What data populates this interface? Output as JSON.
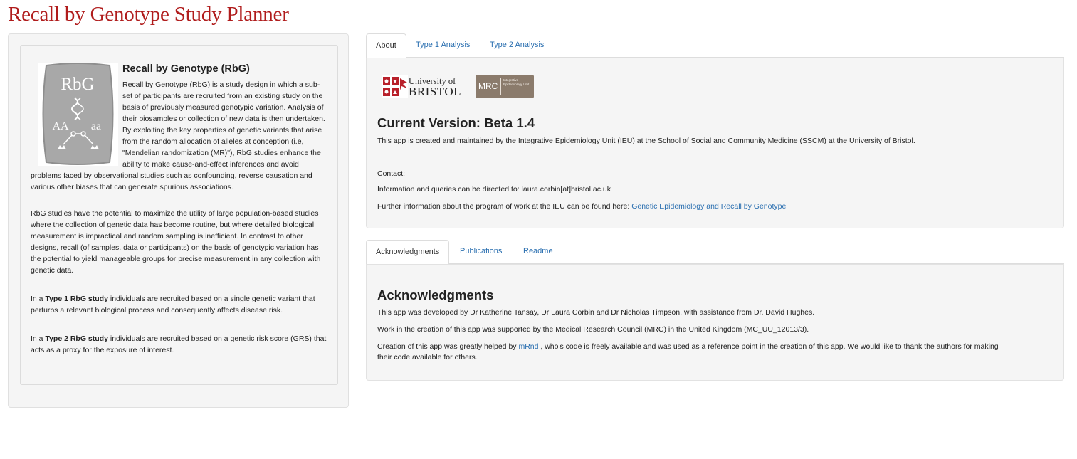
{
  "app": {
    "title": "Recall by Genotype Study Planner"
  },
  "sidebar": {
    "logo": {
      "top_text": "RbG",
      "left_text": "AA",
      "right_text": "aa"
    },
    "heading": "Recall by Genotype (RbG)",
    "para1": "Recall by Genotype (RbG) is a study design in which a sub-set of participants are recruited from an existing study on the basis of previously measured genotypic variation. Analysis of their biosamples or collection of new data is then undertaken. By exploiting the key properties of genetic variants that arise from the random allocation of alleles at conception (i.e, \"Mendelian randomization (MR)\"), RbG studies enhance the ability to make cause-and-effect inferences and avoid problems faced by observational studies such as confounding, reverse causation and various other biases that can generate spurious associations.",
    "para2": "RbG studies have the potential to maximize the utility of large population-based studies where the collection of genetic data has become routine, but where detailed biological measurement is impractical and random sampling is inefficient. In contrast to other designs, recall (of samples, data or participants) on the basis of genotypic variation has the potential to yield manageable groups for precise measurement in any collection with genetic data.",
    "para3_prefix": "In a ",
    "para3_bold": "Type 1 RbG study",
    "para3_rest": " individuals are recruited based on a single genetic variant that perturbs a relevant biological process and consequently affects disease risk.",
    "para4_prefix": "In a ",
    "para4_bold": "Type 2 RbG study",
    "para4_rest": " individuals are recruited based on a genetic risk score (GRS) that acts as a proxy for the exposure of interest."
  },
  "top_tabs": [
    {
      "label": "About",
      "active": true
    },
    {
      "label": "Type 1 Analysis",
      "active": false
    },
    {
      "label": "Type 2 Analysis",
      "active": false
    }
  ],
  "about": {
    "bristol_university": "University of",
    "bristol_name": "BRISTOL",
    "mrc_label": "MRC",
    "mrc_sub": "Integrative Epidemiology Unit",
    "version_heading": "Current Version: Beta 1.4",
    "description": "This app is created and maintained by the Integrative Epidemiology Unit (IEU) at the School of Social and Community Medicine (SSCM) at the University of Bristol.",
    "contact_label": "Contact:",
    "contact_text": "Information and queries can be directed to: laura.corbin[at]bristol.ac.uk",
    "further_text": "Further information about the program of work at the IEU can be found here: ",
    "further_link": "Genetic Epidemiology and Recall by Genotype"
  },
  "bottom_tabs": [
    {
      "label": "Acknowledgments",
      "active": true
    },
    {
      "label": "Publications",
      "active": false
    },
    {
      "label": "Readme",
      "active": false
    }
  ],
  "acknowledgments": {
    "heading": "Acknowledgments",
    "line1": "This app was developed by Dr Katherine Tansay, Dr Laura Corbin and Dr Nicholas Timpson, with assistance from Dr. David Hughes.",
    "line2": "Work in the creation of this app was supported by the Medical Research Council (MRC) in the United Kingdom (MC_UU_12013/3).",
    "line3_prefix": "Creation of this app was greatly helped by ",
    "line3_link": "mRnd",
    "line3_rest": " , who's code is freely available and was used as a reference point in the creation of this app. We would like to thank the authors for making",
    "line3_cont": "their code available for others."
  }
}
